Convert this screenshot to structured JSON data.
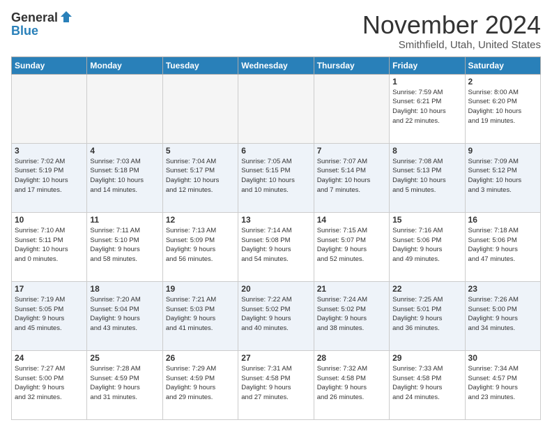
{
  "header": {
    "logo": {
      "general": "General",
      "blue": "Blue"
    },
    "title": "November 2024",
    "location": "Smithfield, Utah, United States"
  },
  "weekdays": [
    "Sunday",
    "Monday",
    "Tuesday",
    "Wednesday",
    "Thursday",
    "Friday",
    "Saturday"
  ],
  "weeks": [
    [
      {
        "day": "",
        "info": ""
      },
      {
        "day": "",
        "info": ""
      },
      {
        "day": "",
        "info": ""
      },
      {
        "day": "",
        "info": ""
      },
      {
        "day": "",
        "info": ""
      },
      {
        "day": "1",
        "info": "Sunrise: 7:59 AM\nSunset: 6:21 PM\nDaylight: 10 hours\nand 22 minutes."
      },
      {
        "day": "2",
        "info": "Sunrise: 8:00 AM\nSunset: 6:20 PM\nDaylight: 10 hours\nand 19 minutes."
      }
    ],
    [
      {
        "day": "3",
        "info": "Sunrise: 7:02 AM\nSunset: 5:19 PM\nDaylight: 10 hours\nand 17 minutes."
      },
      {
        "day": "4",
        "info": "Sunrise: 7:03 AM\nSunset: 5:18 PM\nDaylight: 10 hours\nand 14 minutes."
      },
      {
        "day": "5",
        "info": "Sunrise: 7:04 AM\nSunset: 5:17 PM\nDaylight: 10 hours\nand 12 minutes."
      },
      {
        "day": "6",
        "info": "Sunrise: 7:05 AM\nSunset: 5:15 PM\nDaylight: 10 hours\nand 10 minutes."
      },
      {
        "day": "7",
        "info": "Sunrise: 7:07 AM\nSunset: 5:14 PM\nDaylight: 10 hours\nand 7 minutes."
      },
      {
        "day": "8",
        "info": "Sunrise: 7:08 AM\nSunset: 5:13 PM\nDaylight: 10 hours\nand 5 minutes."
      },
      {
        "day": "9",
        "info": "Sunrise: 7:09 AM\nSunset: 5:12 PM\nDaylight: 10 hours\nand 3 minutes."
      }
    ],
    [
      {
        "day": "10",
        "info": "Sunrise: 7:10 AM\nSunset: 5:11 PM\nDaylight: 10 hours\nand 0 minutes."
      },
      {
        "day": "11",
        "info": "Sunrise: 7:11 AM\nSunset: 5:10 PM\nDaylight: 9 hours\nand 58 minutes."
      },
      {
        "day": "12",
        "info": "Sunrise: 7:13 AM\nSunset: 5:09 PM\nDaylight: 9 hours\nand 56 minutes."
      },
      {
        "day": "13",
        "info": "Sunrise: 7:14 AM\nSunset: 5:08 PM\nDaylight: 9 hours\nand 54 minutes."
      },
      {
        "day": "14",
        "info": "Sunrise: 7:15 AM\nSunset: 5:07 PM\nDaylight: 9 hours\nand 52 minutes."
      },
      {
        "day": "15",
        "info": "Sunrise: 7:16 AM\nSunset: 5:06 PM\nDaylight: 9 hours\nand 49 minutes."
      },
      {
        "day": "16",
        "info": "Sunrise: 7:18 AM\nSunset: 5:06 PM\nDaylight: 9 hours\nand 47 minutes."
      }
    ],
    [
      {
        "day": "17",
        "info": "Sunrise: 7:19 AM\nSunset: 5:05 PM\nDaylight: 9 hours\nand 45 minutes."
      },
      {
        "day": "18",
        "info": "Sunrise: 7:20 AM\nSunset: 5:04 PM\nDaylight: 9 hours\nand 43 minutes."
      },
      {
        "day": "19",
        "info": "Sunrise: 7:21 AM\nSunset: 5:03 PM\nDaylight: 9 hours\nand 41 minutes."
      },
      {
        "day": "20",
        "info": "Sunrise: 7:22 AM\nSunset: 5:02 PM\nDaylight: 9 hours\nand 40 minutes."
      },
      {
        "day": "21",
        "info": "Sunrise: 7:24 AM\nSunset: 5:02 PM\nDaylight: 9 hours\nand 38 minutes."
      },
      {
        "day": "22",
        "info": "Sunrise: 7:25 AM\nSunset: 5:01 PM\nDaylight: 9 hours\nand 36 minutes."
      },
      {
        "day": "23",
        "info": "Sunrise: 7:26 AM\nSunset: 5:00 PM\nDaylight: 9 hours\nand 34 minutes."
      }
    ],
    [
      {
        "day": "24",
        "info": "Sunrise: 7:27 AM\nSunset: 5:00 PM\nDaylight: 9 hours\nand 32 minutes."
      },
      {
        "day": "25",
        "info": "Sunrise: 7:28 AM\nSunset: 4:59 PM\nDaylight: 9 hours\nand 31 minutes."
      },
      {
        "day": "26",
        "info": "Sunrise: 7:29 AM\nSunset: 4:59 PM\nDaylight: 9 hours\nand 29 minutes."
      },
      {
        "day": "27",
        "info": "Sunrise: 7:31 AM\nSunset: 4:58 PM\nDaylight: 9 hours\nand 27 minutes."
      },
      {
        "day": "28",
        "info": "Sunrise: 7:32 AM\nSunset: 4:58 PM\nDaylight: 9 hours\nand 26 minutes."
      },
      {
        "day": "29",
        "info": "Sunrise: 7:33 AM\nSunset: 4:58 PM\nDaylight: 9 hours\nand 24 minutes."
      },
      {
        "day": "30",
        "info": "Sunrise: 7:34 AM\nSunset: 4:57 PM\nDaylight: 9 hours\nand 23 minutes."
      }
    ]
  ]
}
